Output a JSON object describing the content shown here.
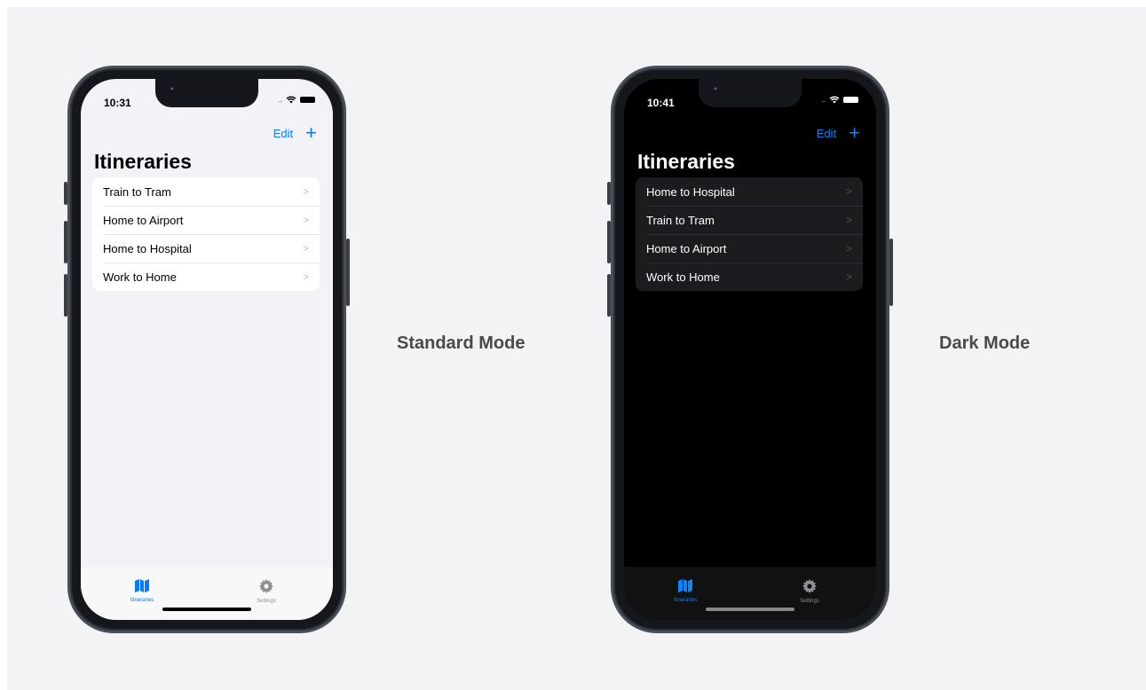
{
  "light_phone": {
    "time": "10:31",
    "edit_label": "Edit",
    "add_label": "+",
    "title": "Itineraries",
    "items": [
      {
        "label": "Train to Tram"
      },
      {
        "label": "Home to Airport"
      },
      {
        "label": "Home to Hospital"
      },
      {
        "label": "Work to Home"
      }
    ],
    "tabs": [
      {
        "label": "Itineraries",
        "icon": "map-icon",
        "active": true
      },
      {
        "label": "Settings",
        "icon": "gear-icon",
        "active": false
      }
    ]
  },
  "dark_phone": {
    "time": "10:41",
    "edit_label": "Edit",
    "add_label": "+",
    "title": "Itineraries",
    "items": [
      {
        "label": "Home to Hospital"
      },
      {
        "label": "Train to Tram"
      },
      {
        "label": "Home to Airport"
      },
      {
        "label": "Work to Home"
      }
    ],
    "tabs": [
      {
        "label": "Itineraries",
        "icon": "map-icon",
        "active": true
      },
      {
        "label": "Settings",
        "icon": "gear-icon",
        "active": false
      }
    ]
  },
  "captions": {
    "standard": "Standard Mode",
    "dark": "Dark Mode"
  },
  "colors": {
    "accent_light": "#007aff",
    "accent_dark": "#0a84ff",
    "page_background": "#f3f3f6"
  }
}
